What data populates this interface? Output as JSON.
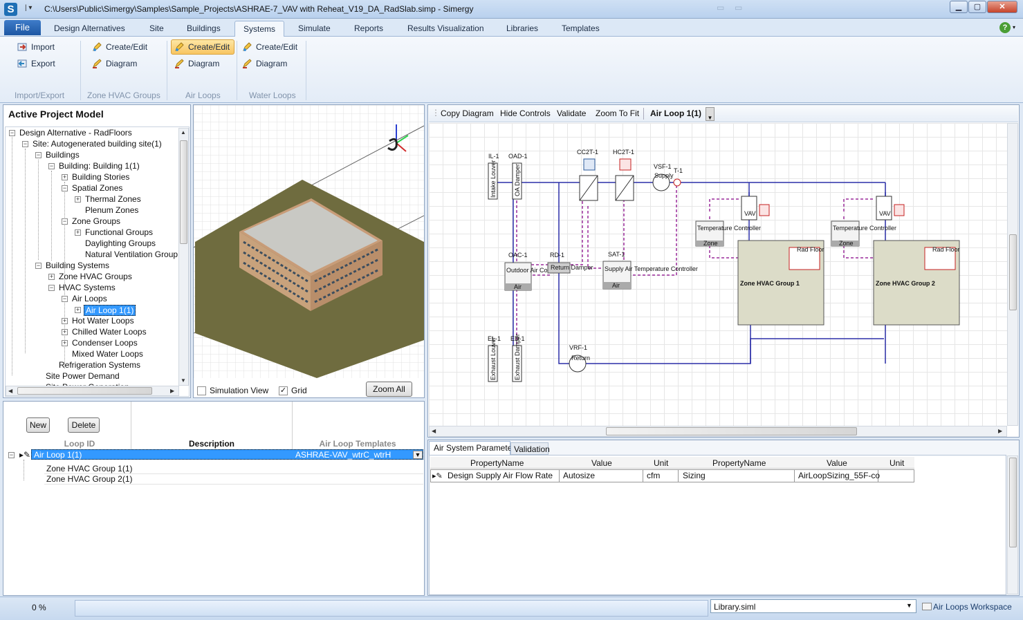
{
  "window": {
    "title": "C:\\Users\\Public\\Simergy\\Samples\\Sample_Projects\\ASHRAE-7_VAV with Reheat_V19_DA_RadSlab.simp - Simergy",
    "logo": "S",
    "min_icon": "minimize-icon",
    "max_icon": "maximize-icon",
    "close_icon": "close-icon"
  },
  "ribbon": {
    "file_label": "File",
    "tabs": [
      "Design Alternatives",
      "Site",
      "Buildings",
      "Systems",
      "Simulate",
      "Reports",
      "Results Visualization",
      "Libraries",
      "Templates"
    ],
    "selected_tab": "Systems",
    "help": "?",
    "groups": {
      "import_export": {
        "label": "Import/Export",
        "import": "Import",
        "export": "Export"
      },
      "zone_hvac": {
        "label": "Zone HVAC Groups",
        "create": "Create/Edit",
        "diagram": "Diagram"
      },
      "air_loops": {
        "label": "Air Loops",
        "create": "Create/Edit",
        "diagram": "Diagram"
      },
      "water_loops": {
        "label": "Water Loops",
        "create": "Create/Edit",
        "diagram": "Diagram"
      }
    }
  },
  "tree": {
    "title": "Active Project Model",
    "nodes": [
      "Design Alternative - RadFloors",
      "Site: Autogenerated building site(1)",
      "Buildings",
      "Building: Building  1(1)",
      "Building Stories",
      "Spatial Zones",
      "Thermal Zones",
      "Plenum Zones",
      "Zone Groups",
      "Functional Groups",
      "Daylighting Groups",
      "Natural Ventilation Group",
      "Building Systems",
      "Zone HVAC Groups",
      "HVAC Systems",
      "Air Loops",
      "Air Loop  1(1)",
      "Hot Water Loops",
      "Chilled Water Loops",
      "Condenser Loops",
      "Mixed Water Loops",
      "Refrigeration Systems",
      "Site Power Demand",
      "Site Power Generation"
    ],
    "selected": "Air Loop  1(1)"
  },
  "view3d": {
    "simulation_view_label": "Simulation View",
    "simulation_view_checked": false,
    "grid_label": "Grid",
    "grid_checked": true,
    "zoom_all": "Zoom All"
  },
  "loop_grid": {
    "new": "New",
    "delete": "Delete",
    "headers": [
      "Loop ID",
      "Description",
      "Air Loop Templates"
    ],
    "row": {
      "id": "Air Loop  1(1)",
      "description": "",
      "template": "ASHRAE-VAV_wtrC_wtrH"
    },
    "children": [
      "Zone HVAC Group  1(1)",
      "Zone HVAC Group  2(1)"
    ]
  },
  "diagram_toolbar": {
    "copy": "Copy Diagram",
    "hide": "Hide Controls",
    "validate": "Validate",
    "zoom": "Zoom To Fit",
    "loop": "Air Loop  1(1)"
  },
  "diagram": {
    "IL": "IL-1",
    "OAD": "OAD-1",
    "CC": "CC2T-1",
    "HC": "HC2T-1",
    "VSF": "VSF-1",
    "T": "T-1",
    "OAC": "OAC-1",
    "RD": "RD-1",
    "SAT": "SAT-1",
    "EL": "EL-1",
    "ED": "ED-1",
    "VRF": "VRF-1",
    "intake_louver": "Intake Louver",
    "oa_damper": "OA Damper",
    "exhaust_louver": "Exhaust Louver",
    "exhaust_damper": "Exhaust Damper",
    "oac_text": "Outdoor Air Controller",
    "air": "Air",
    "return_damper": "Return Damper",
    "sat_text": "Supply Air Temperature Controller",
    "supply": "Supply",
    "return": "Return",
    "vav": "VAV",
    "temp_ctrl": "Temperature Controller",
    "zone": "Zone",
    "rad_floor": "Rad Floor",
    "zone_group_1": "Zone HVAC Group  1",
    "zone_group_2": "Zone HVAC Group  2"
  },
  "params": {
    "tabs": [
      "Air System Parameters",
      "Validation"
    ],
    "headers": [
      "PropertyName",
      "Value",
      "Unit",
      "PropertyName",
      "Value",
      "Unit"
    ],
    "row": [
      "Design Supply Air Flow Rate",
      "Autosize",
      "cfm",
      "Sizing",
      "AirLoopSizing_55F-co",
      ""
    ]
  },
  "status": {
    "progress": "0 %",
    "library": "Library.siml",
    "workspace": "Air Loops Workspace"
  },
  "colors": {
    "accent": "#3399ff",
    "duct": "#2b2fa8",
    "control": "#9a2a9a"
  }
}
